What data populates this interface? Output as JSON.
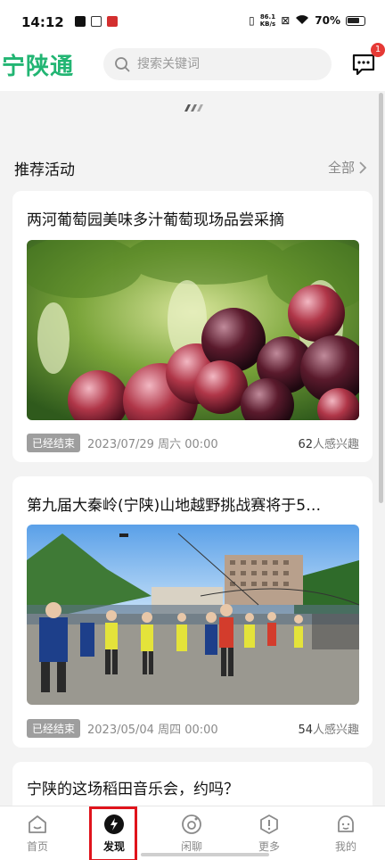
{
  "status_bar": {
    "time": "14:12",
    "net_speed_value": "86.1",
    "net_speed_unit": "KB/s",
    "battery": "70%"
  },
  "header": {
    "logo_text": "宁陕通",
    "search_placeholder": "搜索关键词",
    "message_badge": "1"
  },
  "section": {
    "title": "推荐活动",
    "more_label": "全部"
  },
  "cards": [
    {
      "title": "两河葡萄园美味多汁葡萄现场品尝采摘",
      "status": "已经结束",
      "date": "2023/07/29 周六 00:00",
      "interest_count": "62",
      "interest_label": "人感兴趣",
      "image": "grape-photo"
    },
    {
      "title": "第九届大秦岭(宁陕)山地越野挑战赛将于5…",
      "status": "已经结束",
      "date": "2023/05/04 周四 00:00",
      "interest_count": "54",
      "interest_label": "人感兴趣",
      "image": "marathon-photo"
    },
    {
      "title": "宁陕的这场稻田音乐会，约吗？"
    }
  ],
  "tabbar": {
    "items": [
      {
        "label": "首页",
        "icon": "home-icon"
      },
      {
        "label": "发现",
        "icon": "discover-icon",
        "active": true
      },
      {
        "label": "闲聊",
        "icon": "chat-icon"
      },
      {
        "label": "更多",
        "icon": "more-icon"
      },
      {
        "label": "我的",
        "icon": "profile-icon"
      }
    ]
  },
  "colors": {
    "brand": "#22b573",
    "badge": "#e53935",
    "highlight": "#e0141c"
  }
}
